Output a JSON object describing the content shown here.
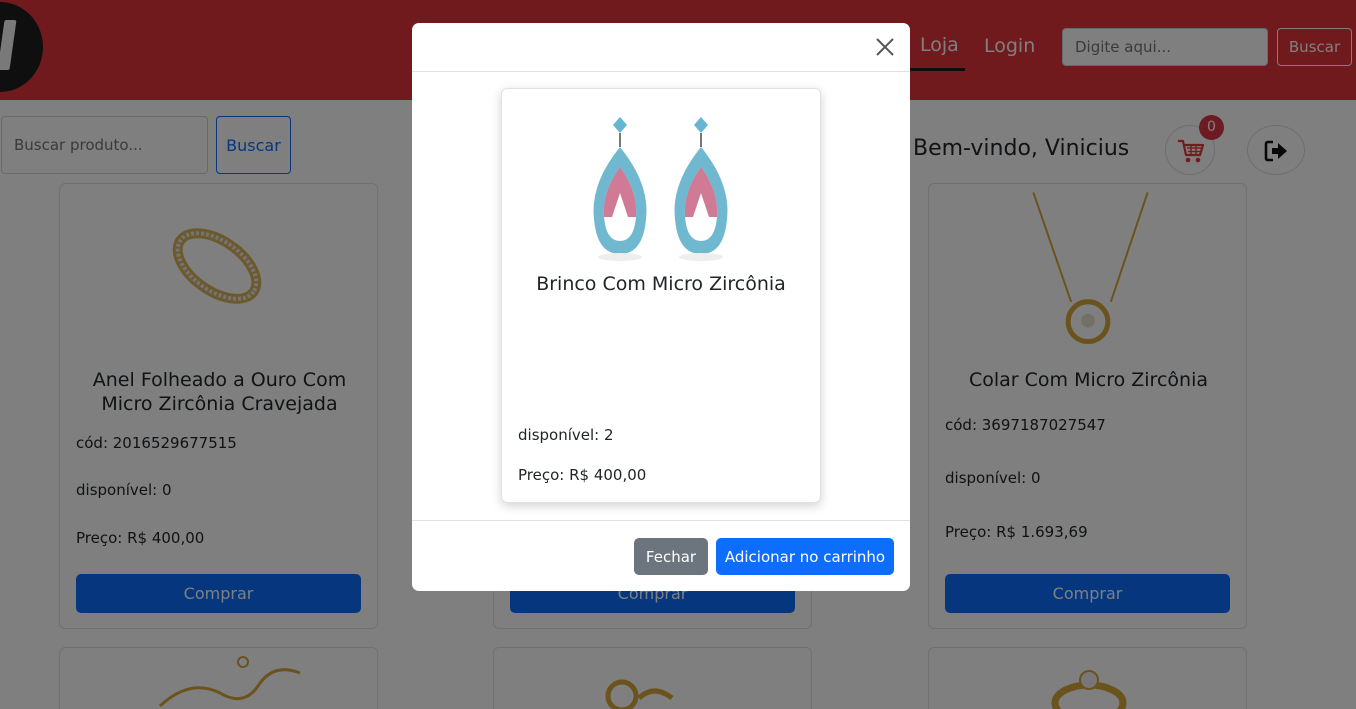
{
  "header": {
    "nav": {
      "loja": "Loja",
      "login": "Login"
    },
    "search": {
      "placeholder": "Digite aqui...",
      "button": "Buscar"
    }
  },
  "subbar": {
    "search": {
      "placeholder": "Buscar produto...",
      "button": "Buscar"
    },
    "welcome": "Bem-vindo, Vinicius",
    "cart_count": "0"
  },
  "products": [
    {
      "title": "Anel Folheado a Ouro Com Micro Zircônia Cravejada",
      "code": "cód: 2016529677515",
      "stock": "disponível: 0",
      "price": "Preço: R$ 400,00",
      "button": "Comprar"
    },
    {
      "title": "",
      "code": "",
      "stock": "",
      "price": "",
      "button": "Comprar"
    },
    {
      "title": "Colar Com Micro Zircônia",
      "code": "cód: 3697187027547",
      "stock": "disponível: 0",
      "price": "Preço: R$ 1.693,69",
      "button": "Comprar"
    }
  ],
  "modal": {
    "product": {
      "title": "Brinco Com Micro Zircônia",
      "stock": "disponível: 2",
      "price": "Preço: R$ 400,00"
    },
    "close_button": "Fechar",
    "add_button": "Adicionar no carrinho"
  },
  "colors": {
    "header": "#e0343c",
    "primary": "#0d6efd",
    "secondary": "#6c757d",
    "badge": "#dc3545"
  },
  "icons": [
    "close-icon",
    "cart-icon",
    "logout-icon"
  ]
}
